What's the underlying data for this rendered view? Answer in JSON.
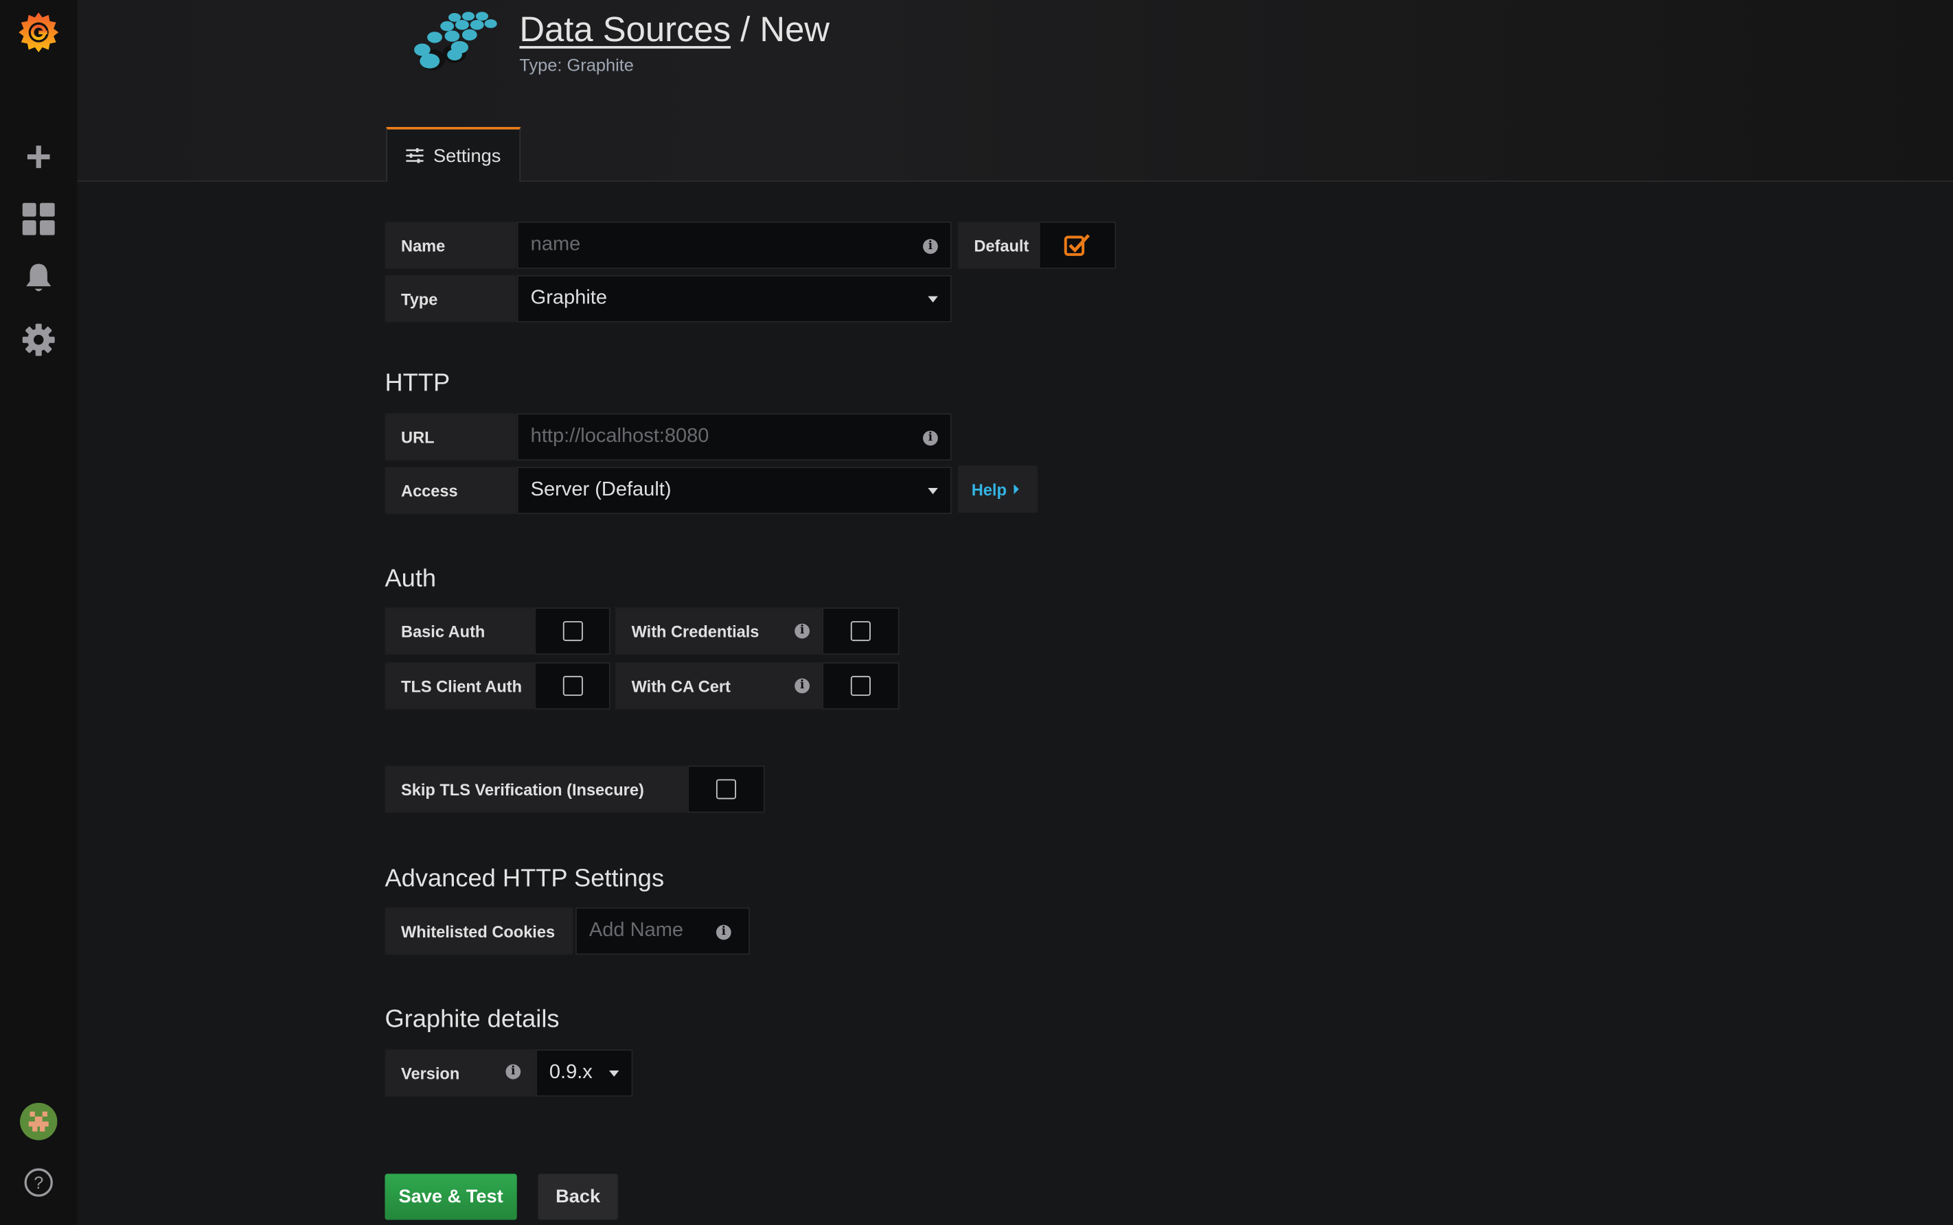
{
  "header": {
    "title_link": "Data Sources",
    "title_sep": " / ",
    "title_rest": "New",
    "subtitle": "Type: Graphite"
  },
  "tabs": [
    {
      "label": "Settings",
      "icon": "sliders-icon",
      "active": true
    }
  ],
  "sidebar": {
    "icons": [
      "grafana-logo-icon",
      "plus-icon",
      "dashboards-icon",
      "bell-icon",
      "gear-icon",
      "avatar",
      "help-icon"
    ]
  },
  "form": {
    "name_label": "Name",
    "name_placeholder": "name",
    "default_label": "Default",
    "default_checked": true,
    "type_label": "Type",
    "type_value": "Graphite"
  },
  "http": {
    "title": "HTTP",
    "url_label": "URL",
    "url_placeholder": "http://localhost:8080",
    "access_label": "Access",
    "access_value": "Server (Default)",
    "help_label": "Help"
  },
  "auth": {
    "title": "Auth",
    "basic_auth": "Basic Auth",
    "with_credentials": "With Credentials",
    "tls_client_auth": "TLS Client Auth",
    "with_ca_cert": "With CA Cert",
    "skip_tls": "Skip TLS Verification (Insecure)"
  },
  "advanced": {
    "title": "Advanced HTTP Settings",
    "cookies_label": "Whitelisted Cookies",
    "cookies_placeholder": "Add Name"
  },
  "graphite": {
    "title": "Graphite details",
    "version_label": "Version",
    "version_value": "0.9.x"
  },
  "actions": {
    "save": "Save & Test",
    "back": "Back"
  },
  "colors": {
    "accent": "#eb7b18",
    "primary": "#299c46",
    "link": "#33b5e5"
  }
}
